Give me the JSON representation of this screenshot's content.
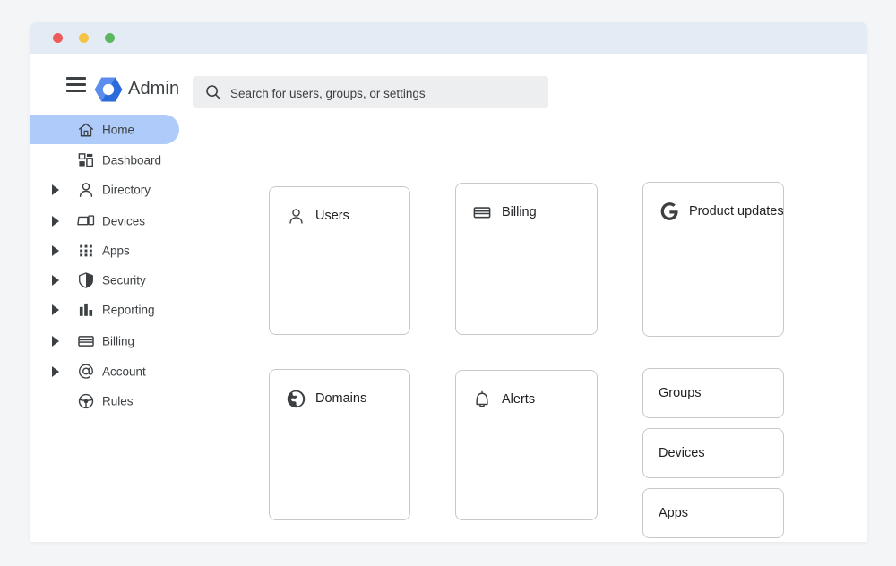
{
  "window": {
    "traffic_lights": [
      {
        "name": "close",
        "color": "#ed5c5c"
      },
      {
        "name": "minimize",
        "color": "#f5c344"
      },
      {
        "name": "maximize",
        "color": "#5cb860"
      }
    ],
    "titlebar_color": "#e3ecf4"
  },
  "topbar": {
    "menu_icon": "hamburger-icon",
    "brand_logo_icon": "google-admin-hexagon-icon",
    "brand_title": "Admin",
    "search": {
      "icon": "search-icon",
      "placeholder": "Search for users, groups, or settings",
      "value": ""
    }
  },
  "sidebar": {
    "items": [
      {
        "label": "Home",
        "icon": "home-icon",
        "expandable": false,
        "active": true
      },
      {
        "label": "Dashboard",
        "icon": "dashboard-icon",
        "expandable": false,
        "active": false
      },
      {
        "label": "Directory",
        "icon": "person-icon",
        "expandable": true,
        "active": false
      },
      {
        "label": "Devices",
        "icon": "devices-icon",
        "expandable": true,
        "active": false
      },
      {
        "label": "Apps",
        "icon": "apps-grid-icon",
        "expandable": true,
        "active": false
      },
      {
        "label": "Security",
        "icon": "shield-icon",
        "expandable": true,
        "active": false
      },
      {
        "label": "Reporting",
        "icon": "bar-chart-icon",
        "expandable": true,
        "active": false
      },
      {
        "label": "Billing",
        "icon": "credit-card-icon",
        "expandable": true,
        "active": false
      },
      {
        "label": "Account",
        "icon": "at-sign-icon",
        "expandable": true,
        "active": false
      },
      {
        "label": "Rules",
        "icon": "steering-wheel-icon",
        "expandable": false,
        "active": false
      }
    ],
    "active_highlight_color": "#aecbfa"
  },
  "main": {
    "cards": [
      {
        "title": "Users",
        "icon": "person-icon"
      },
      {
        "title": "Billing",
        "icon": "credit-card-icon"
      },
      {
        "title": "Product updates",
        "icon": "google-g-icon"
      },
      {
        "title": "Domains",
        "icon": "globe-icon"
      },
      {
        "title": "Alerts",
        "icon": "bell-icon"
      }
    ],
    "mini_cards": [
      {
        "title": "Groups"
      },
      {
        "title": "Devices"
      },
      {
        "title": "Apps"
      }
    ]
  },
  "colors": {
    "text": "#3c4043",
    "card_border": "#c6c9cc",
    "page_background": "#f4f5f6",
    "brand_blue_light": "#4f86e8",
    "brand_blue_dark": "#2a66d9"
  }
}
